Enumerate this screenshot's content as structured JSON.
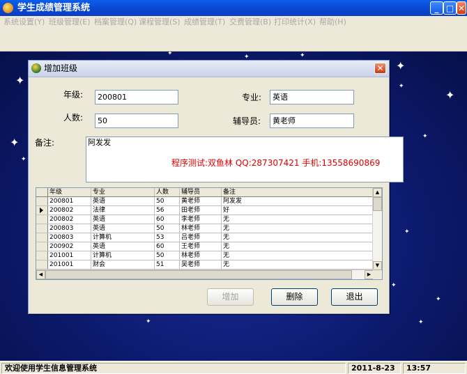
{
  "window": {
    "title": "学生成绩管理系统"
  },
  "menu": {
    "items": [
      {
        "label": "系统设置(Y)"
      },
      {
        "label": "班级管理(E)"
      },
      {
        "label": "档案管理(Q)"
      },
      {
        "label": "课程管理(S)"
      },
      {
        "label": "成绩管理(T)"
      },
      {
        "label": "交费管理(B)"
      },
      {
        "label": "打印统计(X)"
      },
      {
        "label": "帮助(H)"
      }
    ]
  },
  "dialog": {
    "title": "增加班级",
    "grade_label": "年级:",
    "grade_value": "200801",
    "major_label": "专业:",
    "major_value": "英语",
    "count_label": "人数:",
    "count_value": "50",
    "tutor_label": "辅导员:",
    "tutor_value": "黄老师",
    "note_label": "备注:",
    "note_value": "阿发发",
    "program_note": "程序测试:双鱼林 QQ:287307421 手机:13558690869",
    "buttons": {
      "add": "增加",
      "delete": "删除",
      "exit": "退出"
    }
  },
  "grid": {
    "columns": [
      "年级",
      "专业",
      "人数",
      "辅导员",
      "备注"
    ],
    "rows": [
      [
        "200801",
        "英语",
        "50",
        "黄老师",
        "阿发发"
      ],
      [
        "200802",
        "法律",
        "56",
        "田老师",
        "好"
      ],
      [
        "200802",
        "英语",
        "60",
        "李老师",
        "无"
      ],
      [
        "200803",
        "英语",
        "50",
        "林老师",
        "无"
      ],
      [
        "200803",
        "计算机",
        "53",
        "吕老师",
        "无"
      ],
      [
        "200902",
        "英语",
        "60",
        "王老师",
        "无"
      ],
      [
        "201001",
        "计算机",
        "50",
        "林老师",
        "无"
      ],
      [
        "201001",
        "财会",
        "51",
        "吴老师",
        "无"
      ]
    ],
    "selected_row": 1
  },
  "statusbar": {
    "message": "欢迎使用学生信息管理系统",
    "date": "2011-8-23",
    "time": "13:57"
  },
  "colors": {
    "titlebar": "#0a5fe8",
    "desktop": "#0c1a6e",
    "red_text": "#e00000"
  }
}
